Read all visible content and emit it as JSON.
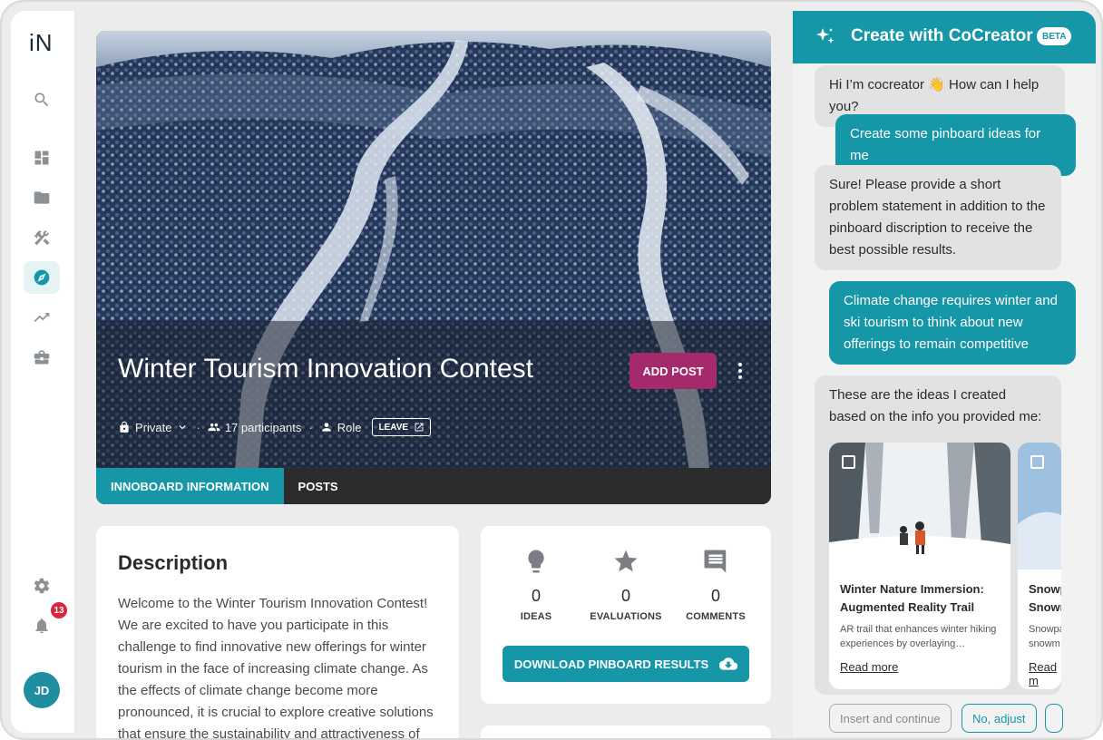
{
  "app": {
    "logo_text": "IN"
  },
  "sidebar": {
    "items": [
      {
        "icon": "search-icon"
      },
      {
        "icon": "dashboard-icon"
      },
      {
        "icon": "folder-icon"
      },
      {
        "icon": "tools-icon"
      },
      {
        "icon": "compass-icon",
        "active": true
      },
      {
        "icon": "trending-icon"
      },
      {
        "icon": "briefcase-icon"
      }
    ],
    "settings_icon": "gear-icon",
    "notifications": {
      "icon": "bell-icon",
      "count": "13"
    },
    "avatar_initials": "JD"
  },
  "hero": {
    "title": "Winter Tourism Innovation Contest",
    "add_post_label": "ADD POST",
    "privacy_label": "Private",
    "participants_label": "17 participants",
    "role_label": "Role",
    "leave_label": "LEAVE",
    "tabs": [
      {
        "label": "INNOBOARD INFORMATION",
        "active": true
      },
      {
        "label": "POSTS",
        "active": false
      }
    ]
  },
  "description": {
    "title": "Description",
    "text": "Welcome to the Winter Tourism Innovation Contest! We are excited to have you participate in this challenge to find innovative new offerings for winter tourism in the face of increasing climate change. As the effects of climate change become more pronounced, it is crucial to explore creative solutions that ensure the sustainability and attractiveness of"
  },
  "stats": {
    "ideas": {
      "value": "0",
      "label": "IDEAS"
    },
    "evaluations": {
      "value": "0",
      "label": "EVALUATIONS"
    },
    "comments": {
      "value": "0",
      "label": "COMMENTS"
    },
    "download_label": "DOWNLOAD PINBOARD RESULTS"
  },
  "chat": {
    "title": "Create with CoCreator",
    "badge": "BETA",
    "messages": [
      {
        "from": "bot",
        "text": "Hi I’m cocreator 👋 How can I help you?"
      },
      {
        "from": "user",
        "text": "Create some pinboard ideas for me"
      },
      {
        "from": "bot",
        "text": "Sure! Please provide a short problem statement in addition to the pinboard discription to receive the best possible results."
      },
      {
        "from": "user",
        "text": "Climate change requires winter and ski tourism to think about new offerings to remain competitive"
      },
      {
        "from": "bot",
        "text": "These are the ideas I created based on the info you provided me:"
      }
    ],
    "ideas": [
      {
        "title": "Winter Nature Immersion: Augmented Reality Trail",
        "desc": "AR trail that enhances winter hiking experiences by overlaying…",
        "link": "Read more"
      },
      {
        "title": "Snowpark Snowm",
        "desc": "Snowpark snowm",
        "link": "Read m"
      }
    ],
    "actions": [
      {
        "label": "Insert and continue"
      },
      {
        "label": "No, adjust"
      }
    ]
  },
  "colors": {
    "accent": "#1597a8",
    "add_post": "#a52a6b",
    "badge": "#d7263d"
  }
}
